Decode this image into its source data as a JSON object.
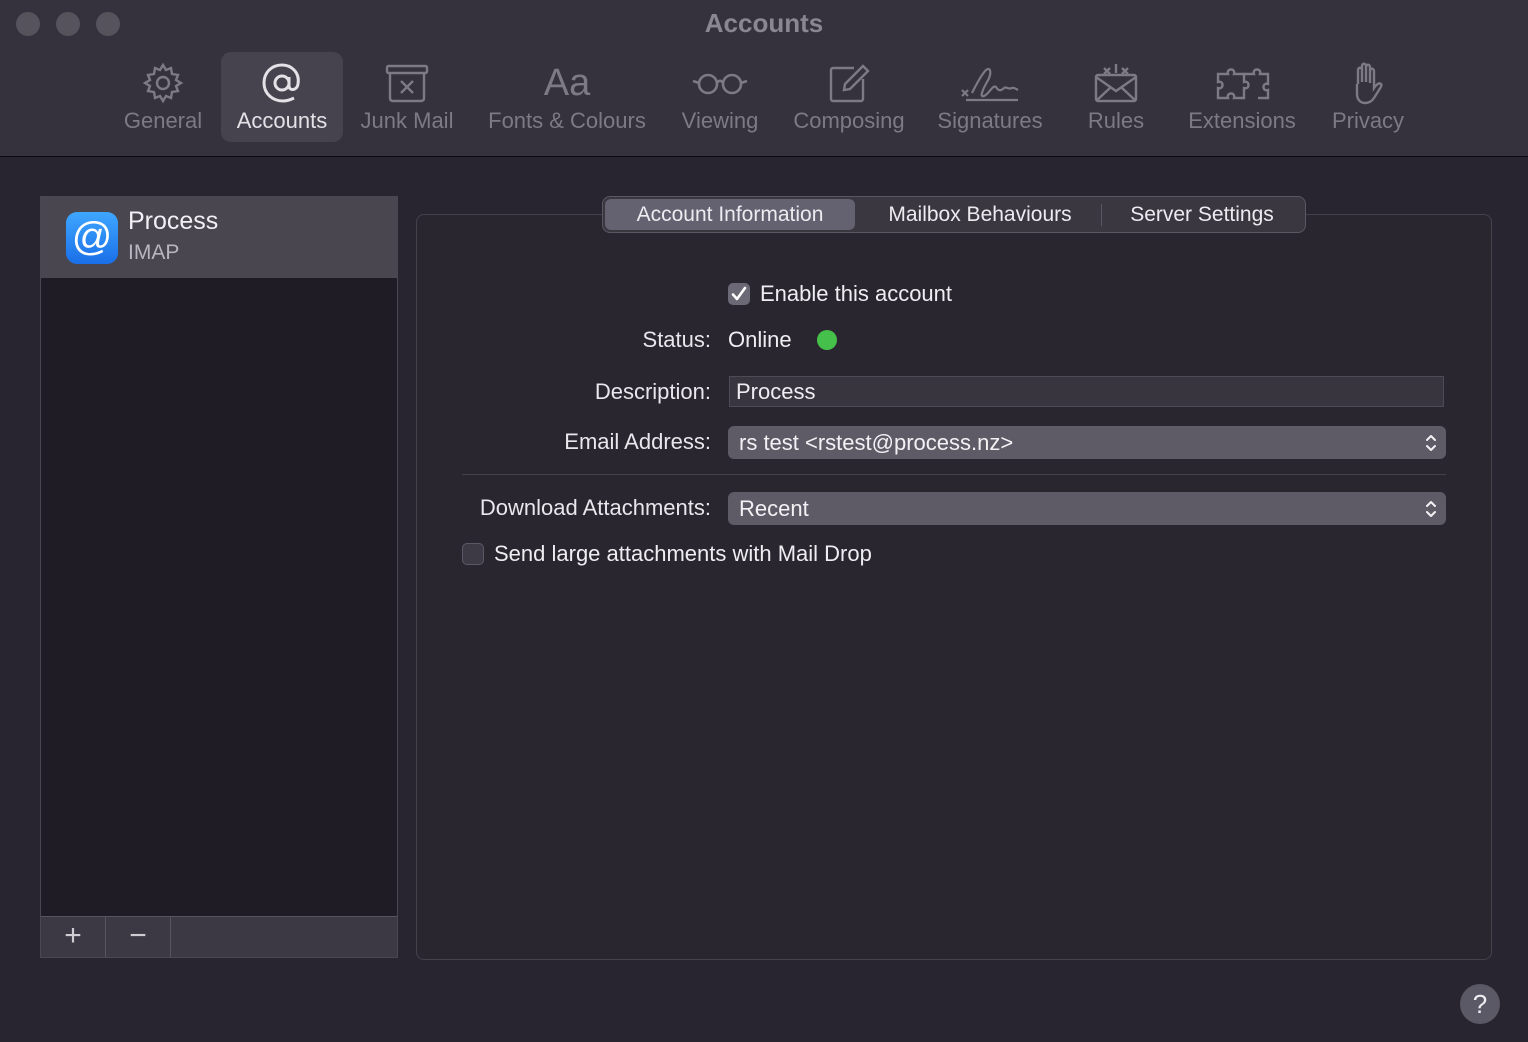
{
  "window": {
    "title": "Accounts"
  },
  "toolbar": {
    "items": [
      {
        "label": "General",
        "icon": "gear-icon"
      },
      {
        "label": "Accounts",
        "icon": "at-sign-icon"
      },
      {
        "label": "Junk Mail",
        "icon": "junk-mail-icon"
      },
      {
        "label": "Fonts & Colours",
        "icon": "fonts-icon",
        "glyph": "Aa"
      },
      {
        "label": "Viewing",
        "icon": "glasses-icon"
      },
      {
        "label": "Composing",
        "icon": "compose-icon"
      },
      {
        "label": "Signatures",
        "icon": "signature-icon"
      },
      {
        "label": "Rules",
        "icon": "rules-envelope-icon"
      },
      {
        "label": "Extensions",
        "icon": "puzzle-icon"
      },
      {
        "label": "Privacy",
        "icon": "hand-icon"
      }
    ],
    "active": "Accounts"
  },
  "accounts": {
    "items": [
      {
        "name": "Process",
        "type": "IMAP",
        "icon": "at-sign-icon",
        "glyph": "@"
      }
    ],
    "add_label": "+",
    "remove_label": "−"
  },
  "tabs": {
    "items": [
      "Account Information",
      "Mailbox Behaviours",
      "Server Settings"
    ],
    "active": "Account Information"
  },
  "account_info": {
    "enable_label": "Enable this account",
    "enable_checked": true,
    "status_label": "Status:",
    "status_value": "Online",
    "status_color": "#45c14b",
    "description_label": "Description:",
    "description_value": "Process",
    "email_label": "Email Address:",
    "email_value": "rs test <rstest@process.nz>",
    "download_label": "Download Attachments:",
    "download_value": "Recent",
    "maildrop_label": "Send large attachments with Mail Drop",
    "maildrop_checked": false
  },
  "help": {
    "label": "?"
  }
}
